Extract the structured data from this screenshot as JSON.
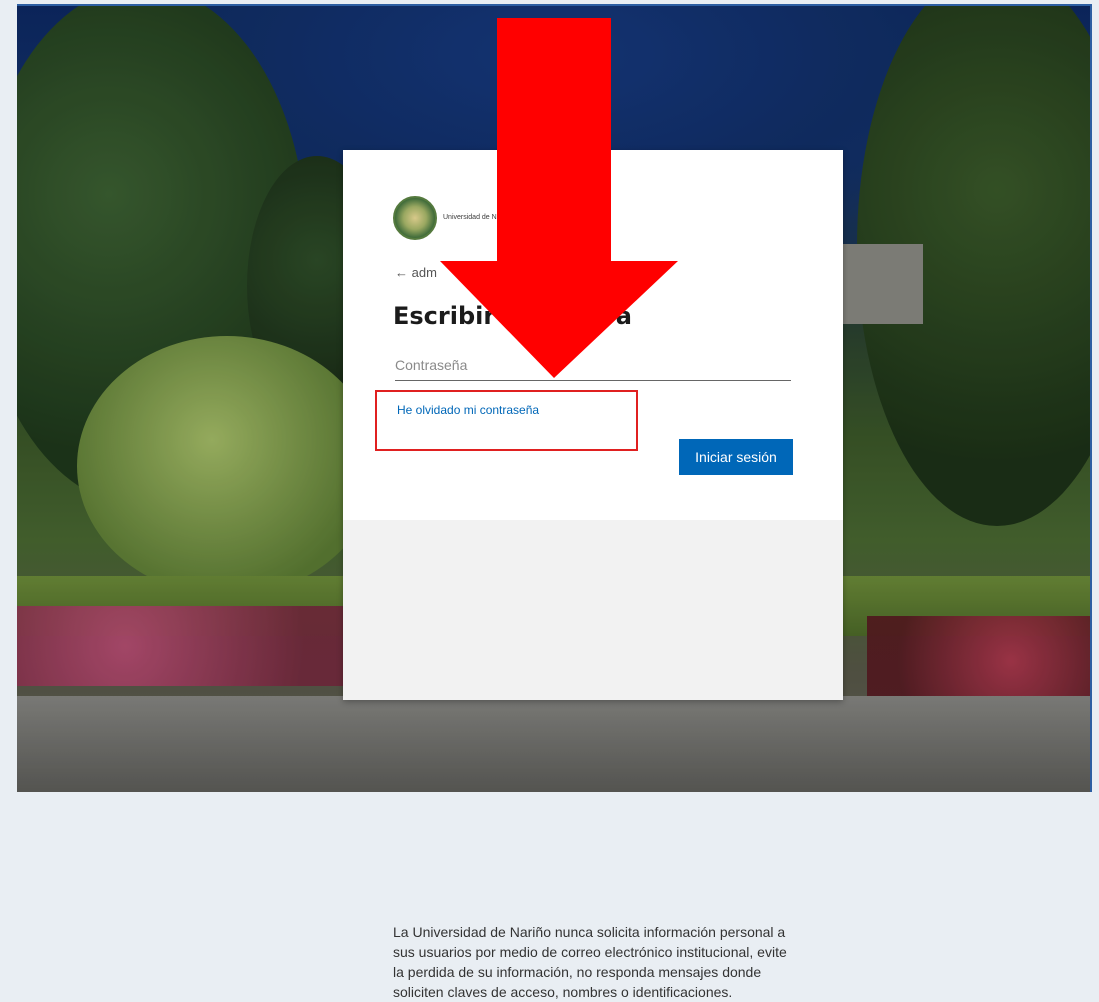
{
  "logo": {
    "icon": "university-seal-icon",
    "text_line1": "Universidad de Nariño",
    "text_line2": ""
  },
  "login": {
    "back_text": "← adm",
    "title": "Escribir c",
    "title_suffix": "a",
    "password_placeholder": "Contraseña",
    "forgot_link": "He olvidado mi contraseña",
    "signin_button": "Iniciar sesión"
  },
  "notice": {
    "text": "La Universidad de Nariño nunca solicita información personal a sus usuarios por medio de correo electrónico institucional, evite la perdida de su información, no responda mensajes donde soliciten claves de acceso, nombres o identificaciones."
  },
  "annotation": {
    "arrow_color": "#ff0000",
    "highlight_color": "#e02020"
  },
  "colors": {
    "accent": "#0067b8"
  }
}
